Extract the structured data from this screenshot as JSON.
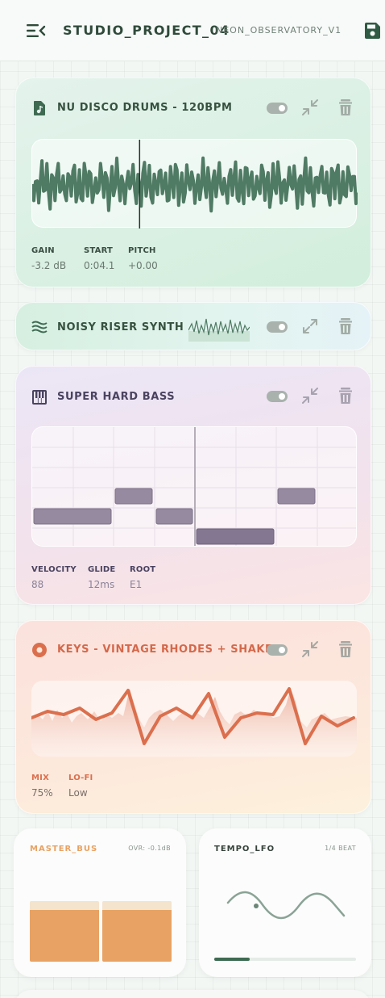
{
  "header": {
    "title": "STUDIO_PROJECT_04",
    "subtitle": "NEON_OBSERVATORY_V1",
    "menu_icon": "menu-collapse-icon",
    "save_icon": "save-icon"
  },
  "tracks": [
    {
      "title": "NU DISCO DRUMS - 120BPM",
      "icon": "audio-file-icon",
      "params": [
        {
          "label": "GAIN",
          "value": "-3.2 dB"
        },
        {
          "label": "START",
          "value": "0:04.1"
        },
        {
          "label": "PITCH",
          "value": "+0.00"
        }
      ],
      "playhead_fraction": 0.33
    },
    {
      "title": "NOISY RISER SYNTH",
      "icon": "waves-icon"
    },
    {
      "title": "SUPER HARD BASS",
      "icon": "piano-icon",
      "params": [
        {
          "label": "VELOCITY",
          "value": "88"
        },
        {
          "label": "GLIDE",
          "value": "12ms"
        },
        {
          "label": "ROOT",
          "value": "E1"
        }
      ]
    },
    {
      "title": "KEYS - VINTAGE RHODES + SHAKER",
      "icon": "record-icon",
      "params": [
        {
          "label": "MIX",
          "value": "75%"
        },
        {
          "label": "LO-FI",
          "value": "Low"
        }
      ]
    }
  ],
  "master": {
    "title": "MASTER_BUS",
    "meta": "OVR: -0.1dB",
    "levels": [
      0.85,
      0.86
    ]
  },
  "tempo": {
    "title": "TEMPO_LFO",
    "meta": "1/4 BEAT",
    "progress": 0.25
  },
  "colors": {
    "accent_green": "#4f7a63",
    "accent_purple": "#9a8fa8",
    "accent_orange": "#db6f4d",
    "meter_orange": "#e8a263"
  }
}
